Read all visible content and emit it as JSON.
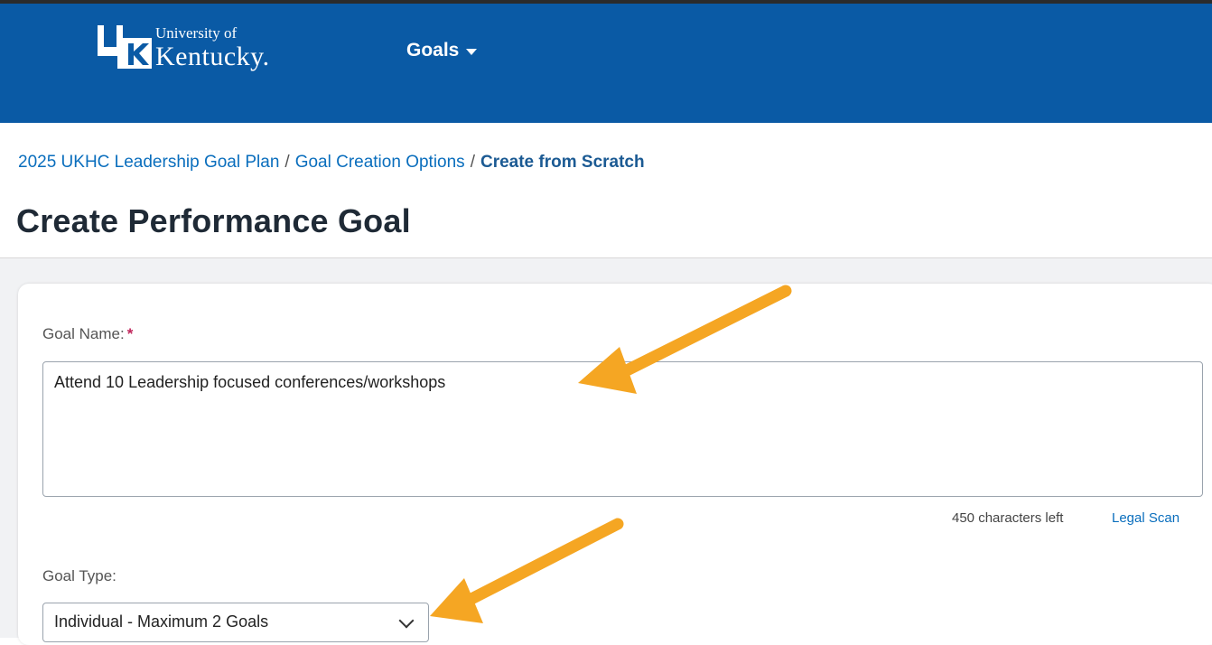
{
  "header": {
    "logo_line1": "University of",
    "logo_line2": "Kentucky.",
    "nav_goals_label": "Goals"
  },
  "breadcrumb": {
    "items": [
      "2025 UKHC Leadership Goal Plan",
      "Goal Creation Options"
    ],
    "separator": "/",
    "current": "Create from Scratch"
  },
  "page_title": "Create Performance Goal",
  "form": {
    "goal_name_label": "Goal Name:",
    "required_marker": "*",
    "goal_name_value": "Attend 10 Leadership focused conferences/workshops",
    "chars_left": "450 characters left",
    "legal_scan": "Legal Scan",
    "goal_type_label": "Goal Type:",
    "goal_type_value": "Individual - Maximum 2 Goals"
  },
  "colors": {
    "header_bg": "#0a5aa5",
    "link": "#0a6ebd",
    "annotation_arrow": "#f5a623",
    "required": "#c0245a"
  }
}
